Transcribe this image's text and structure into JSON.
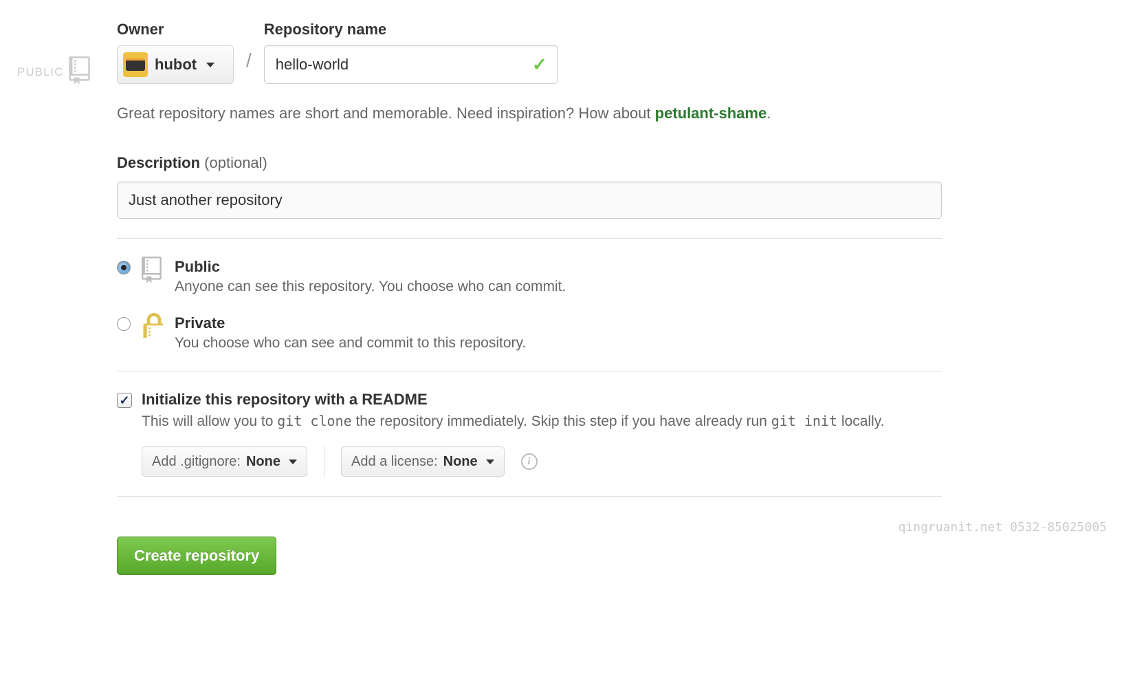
{
  "left_badge": {
    "text": "PUBLIC"
  },
  "owner": {
    "label": "Owner",
    "selected": "hubot"
  },
  "repo_name": {
    "label": "Repository name",
    "value": "hello-world",
    "valid": true
  },
  "hint": {
    "text_before": "Great repository names are short and memorable. Need inspiration? How about ",
    "suggestion": "petulant-shame",
    "text_after": "."
  },
  "description": {
    "label_bold": "Description",
    "label_optional": "(optional)",
    "value": "Just another repository"
  },
  "visibility": {
    "public": {
      "title": "Public",
      "sub": "Anyone can see this repository. You choose who can commit.",
      "checked": true
    },
    "private": {
      "title": "Private",
      "sub": "You choose who can see and commit to this repository.",
      "checked": false
    }
  },
  "readme": {
    "title": "Initialize this repository with a README",
    "sub_before": "This will allow you to ",
    "sub_code1": "git clone",
    "sub_mid": " the repository immediately. Skip this step if you have already run ",
    "sub_code2": "git init",
    "sub_after": " locally.",
    "checked": true
  },
  "gitignore": {
    "prefix": "Add .gitignore: ",
    "value": "None"
  },
  "license": {
    "prefix": "Add a license: ",
    "value": "None"
  },
  "submit": {
    "label": "Create repository"
  },
  "watermark": "qingruanit.net 0532-85025005"
}
